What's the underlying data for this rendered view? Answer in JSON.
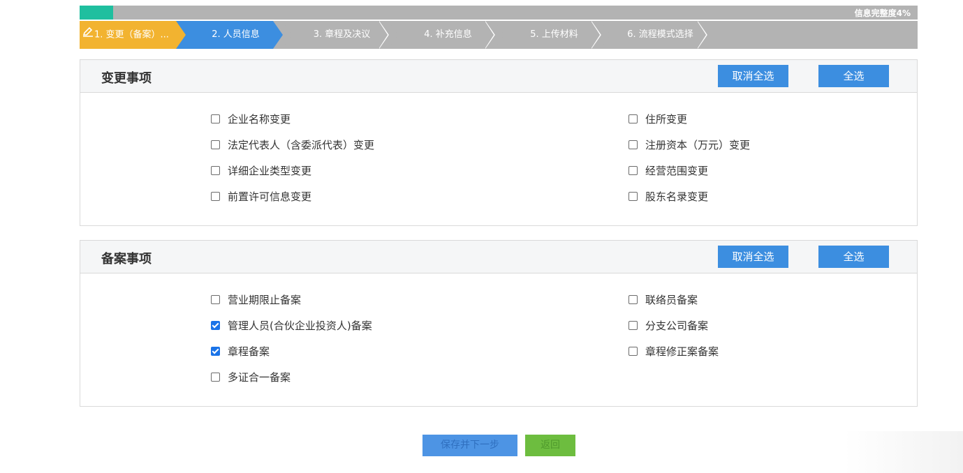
{
  "progress": {
    "label": "信息完整度4%",
    "percent": 4
  },
  "steps": [
    {
      "label": "1. 变更（备案）...",
      "state": "current"
    },
    {
      "label": "2. 人员信息",
      "state": "active"
    },
    {
      "label": "3. 章程及决议",
      "state": "pending"
    },
    {
      "label": "4. 补充信息",
      "state": "pending"
    },
    {
      "label": "5. 上传材料",
      "state": "pending"
    },
    {
      "label": "6. 流程模式选择",
      "state": "pending"
    }
  ],
  "change_panel": {
    "title": "变更事项",
    "cancel_all_label": "取消全选",
    "select_all_label": "全选",
    "items": [
      {
        "label": "企业名称变更",
        "checked": false
      },
      {
        "label": "住所变更",
        "checked": false
      },
      {
        "label": "法定代表人（含委派代表）变更",
        "checked": false
      },
      {
        "label": "注册资本（万元）变更",
        "checked": false
      },
      {
        "label": "详细企业类型变更",
        "checked": false
      },
      {
        "label": "经营范围变更",
        "checked": false
      },
      {
        "label": "前置许可信息变更",
        "checked": false
      },
      {
        "label": "股东名录变更",
        "checked": false
      }
    ]
  },
  "filing_panel": {
    "title": "备案事项",
    "cancel_all_label": "取消全选",
    "select_all_label": "全选",
    "items": [
      {
        "label": "营业期限止备案",
        "checked": false
      },
      {
        "label": "联络员备案",
        "checked": false
      },
      {
        "label": "管理人员(合伙企业投资人)备案",
        "checked": true
      },
      {
        "label": "分支公司备案",
        "checked": false
      },
      {
        "label": "章程备案",
        "checked": true
      },
      {
        "label": "章程修正案备案",
        "checked": false
      },
      {
        "label": "多证合一备案",
        "checked": false
      }
    ]
  },
  "actions": {
    "save_next_label": "保存并下一步",
    "back_label": "返回"
  },
  "colors": {
    "step_current": "#f2b330",
    "step_active": "#3c8ee0",
    "step_pending": "#b3b3b3",
    "progress_fill": "#1fbf9f",
    "button_blue": "#3c8ee0",
    "button_green": "#6dbd3f"
  }
}
